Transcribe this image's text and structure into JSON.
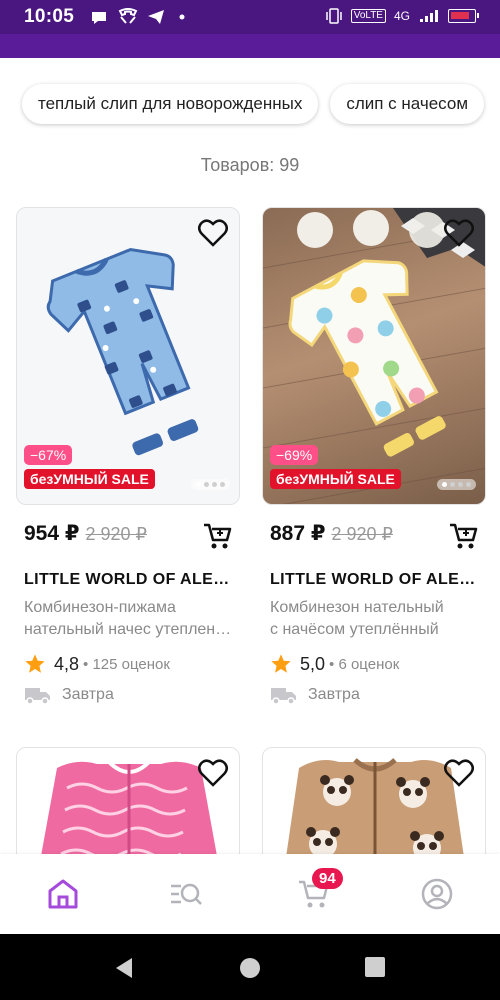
{
  "status_bar": {
    "time": "10:05",
    "lte": "VoLTE",
    "network": "4G"
  },
  "search_chips": [
    "теплый слип для новорожденных",
    "слип с начесом"
  ],
  "product_count": "Товаров: 99",
  "products": [
    {
      "discount": "−67%",
      "sale_label": "безУМНЫЙ SALE",
      "price": "954 ₽",
      "old_price": "2 920 ₽",
      "brand": "LITTLE WORLD OF ALENA",
      "description_line1": "Комбинезон-пижама",
      "description_line2": "нательный начес утепленный",
      "rating": "4,8",
      "reviews": "• 125 оценок",
      "delivery": "Завтра"
    },
    {
      "discount": "−69%",
      "sale_label": "безУМНЫЙ SALE",
      "price": "887 ₽",
      "old_price": "2 920 ₽",
      "brand": "LITTLE WORLD OF ALENA",
      "description_line1": "Комбинезон нательный",
      "description_line2": "с начёсом утеплённый",
      "rating": "5,0",
      "reviews": "• 6 оценок",
      "delivery": "Завтра"
    }
  ],
  "bottom_nav": {
    "cart_count": "94"
  },
  "colors": {
    "brand_purple": "#5b1c9a",
    "accent_purple": "#a54bdb",
    "discount_pink": "#ff4f88",
    "sale_red": "#e2122b",
    "star": "#ff9e10"
  }
}
